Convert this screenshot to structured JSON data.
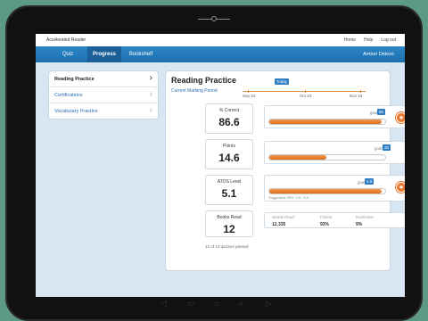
{
  "topbar": {
    "app_title": "Accelerated Reader",
    "links": [
      "Home",
      "Help",
      "Log out"
    ]
  },
  "navbar": {
    "tabs": [
      "Quiz",
      "Progress",
      "Bookshelf"
    ],
    "active_tab": "Progress",
    "user_name": "Amber Delezo"
  },
  "sidebar": {
    "items": [
      {
        "label": "Reading Practice",
        "active": true
      },
      {
        "label": "Certifications",
        "active": false
      },
      {
        "label": "Vocabulary Practice",
        "active": false
      }
    ]
  },
  "main": {
    "title": "Reading Practice",
    "period_label": "Current Marking Period",
    "timeline": {
      "today_label": "Today",
      "dates": [
        "Sep 24",
        "Oct 24",
        "Nov 15"
      ]
    },
    "metrics": [
      {
        "label": "% Correct",
        "value": "86.6",
        "goal_label": "goal",
        "goal_value": "85",
        "progress": 0.97,
        "star": true,
        "note": ""
      },
      {
        "label": "Points",
        "value": "14.6",
        "goal_label": "goal",
        "goal_value": "30",
        "progress": 0.49,
        "star": false,
        "note": ""
      },
      {
        "label": "ATOS Level",
        "value": "5.1",
        "goal_label": "goal",
        "goal_value": "4.8",
        "progress": 0.97,
        "star": true,
        "note": "Suggested ZPD: 3.5 - 5.5"
      }
    ],
    "books": {
      "label": "Books Read",
      "value": "12",
      "words_read_label": "Words Read",
      "words_read_value": "12,335",
      "fiction_label": "Fiction",
      "fiction_value": "93%",
      "nonfiction_label": "Nonfiction",
      "nonfiction_value": "9%"
    },
    "quizzes_passed": "12 of 14 quizzes passed"
  },
  "device": {
    "bottom_icons": [
      "back-icon",
      "windows-icon",
      "home-icon",
      "search-icon",
      "play-icon"
    ]
  },
  "colors": {
    "accent": "#1d6fae",
    "progress": "#e8752a",
    "link": "#2a6fb0"
  }
}
